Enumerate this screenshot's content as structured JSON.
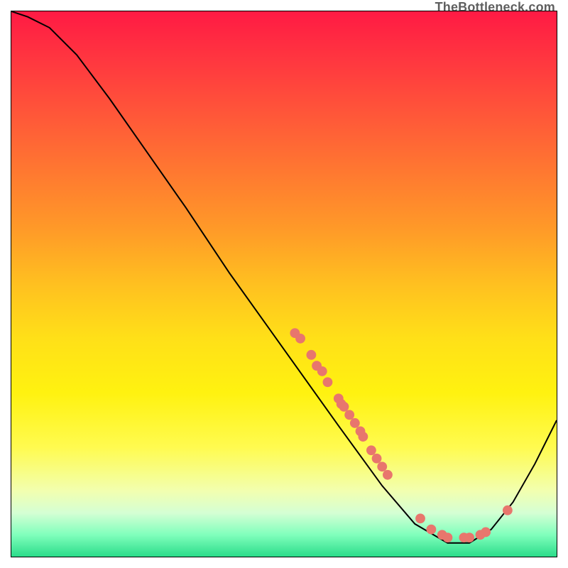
{
  "watermark": "TheBottleneck.com",
  "chart_data": {
    "type": "line",
    "title": "",
    "xlabel": "",
    "ylabel": "",
    "xlim": [
      0,
      100
    ],
    "ylim": [
      0,
      100
    ],
    "gradient_bands": [
      {
        "stop": 0.0,
        "color": "#ff1a44"
      },
      {
        "stop": 0.1,
        "color": "#ff3a3f"
      },
      {
        "stop": 0.2,
        "color": "#ff5a38"
      },
      {
        "stop": 0.3,
        "color": "#ff7a30"
      },
      {
        "stop": 0.4,
        "color": "#ff9a28"
      },
      {
        "stop": 0.5,
        "color": "#ffc020"
      },
      {
        "stop": 0.6,
        "color": "#ffe018"
      },
      {
        "stop": 0.7,
        "color": "#fff210"
      },
      {
        "stop": 0.8,
        "color": "#fffb50"
      },
      {
        "stop": 0.88,
        "color": "#f2ffb0"
      },
      {
        "stop": 0.92,
        "color": "#d4ffd4"
      },
      {
        "stop": 0.96,
        "color": "#80ffbc"
      },
      {
        "stop": 1.0,
        "color": "#2bdc8a"
      }
    ],
    "curve": [
      {
        "x": 0,
        "y": 100
      },
      {
        "x": 3,
        "y": 99
      },
      {
        "x": 7,
        "y": 97
      },
      {
        "x": 12,
        "y": 92
      },
      {
        "x": 18,
        "y": 84
      },
      {
        "x": 25,
        "y": 74
      },
      {
        "x": 32,
        "y": 64
      },
      {
        "x": 40,
        "y": 52
      },
      {
        "x": 50,
        "y": 38
      },
      {
        "x": 60,
        "y": 24
      },
      {
        "x": 68,
        "y": 13
      },
      {
        "x": 74,
        "y": 6
      },
      {
        "x": 80,
        "y": 2.5
      },
      {
        "x": 84,
        "y": 2.5
      },
      {
        "x": 88,
        "y": 5
      },
      {
        "x": 92,
        "y": 10
      },
      {
        "x": 96,
        "y": 17
      },
      {
        "x": 100,
        "y": 25
      }
    ],
    "scatter": [
      {
        "x": 52,
        "y": 41
      },
      {
        "x": 53,
        "y": 40
      },
      {
        "x": 55,
        "y": 37
      },
      {
        "x": 56,
        "y": 35
      },
      {
        "x": 57,
        "y": 34
      },
      {
        "x": 58,
        "y": 32
      },
      {
        "x": 60,
        "y": 29
      },
      {
        "x": 60.5,
        "y": 28
      },
      {
        "x": 61,
        "y": 27.5
      },
      {
        "x": 62,
        "y": 26
      },
      {
        "x": 63,
        "y": 24.5
      },
      {
        "x": 64,
        "y": 23
      },
      {
        "x": 64.5,
        "y": 22
      },
      {
        "x": 66,
        "y": 19.5
      },
      {
        "x": 67,
        "y": 18
      },
      {
        "x": 68,
        "y": 16.5
      },
      {
        "x": 69,
        "y": 15
      },
      {
        "x": 75,
        "y": 7
      },
      {
        "x": 77,
        "y": 5
      },
      {
        "x": 79,
        "y": 4
      },
      {
        "x": 80,
        "y": 3.5
      },
      {
        "x": 83,
        "y": 3.5
      },
      {
        "x": 84,
        "y": 3.5
      },
      {
        "x": 86,
        "y": 4
      },
      {
        "x": 87,
        "y": 4.5
      },
      {
        "x": 91,
        "y": 8.5
      }
    ],
    "scatter_color": "#e8766d",
    "curve_color": "#000000"
  }
}
